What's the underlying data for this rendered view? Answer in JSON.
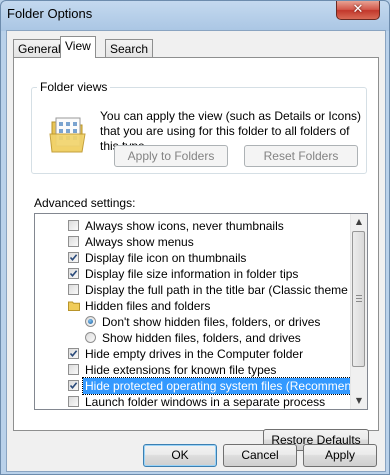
{
  "window": {
    "title": "Folder Options",
    "close_glyph": "✕"
  },
  "tabs": [
    {
      "label": "General",
      "active": false
    },
    {
      "label": "View",
      "active": true
    },
    {
      "label": "Search",
      "active": false
    }
  ],
  "folder_views": {
    "label": "Folder views",
    "icon": "folder-views-icon",
    "description": "You can apply the view (such as Details or Icons) that you are using for this folder to all folders of this type.",
    "apply_button": "Apply to Folders",
    "reset_button": "Reset Folders"
  },
  "advanced": {
    "label": "Advanced settings:",
    "items": [
      {
        "type": "checkbox",
        "label": "Always show icons, never thumbnails",
        "checked": false,
        "indent": 0
      },
      {
        "type": "checkbox",
        "label": "Always show menus",
        "checked": false,
        "indent": 0
      },
      {
        "type": "checkbox",
        "label": "Display file icon on thumbnails",
        "checked": true,
        "indent": 0
      },
      {
        "type": "checkbox",
        "label": "Display file size information in folder tips",
        "checked": true,
        "indent": 0
      },
      {
        "type": "checkbox",
        "label": "Display the full path in the title bar (Classic theme only)",
        "checked": false,
        "indent": 0
      },
      {
        "type": "folder",
        "label": "Hidden files and folders",
        "indent": 0
      },
      {
        "type": "radio",
        "label": "Don't show hidden files, folders, or drives",
        "checked": true,
        "indent": 1
      },
      {
        "type": "radio",
        "label": "Show hidden files, folders, and drives",
        "checked": false,
        "indent": 1
      },
      {
        "type": "checkbox",
        "label": "Hide empty drives in the Computer folder",
        "checked": true,
        "indent": 0
      },
      {
        "type": "checkbox",
        "label": "Hide extensions for known file types",
        "checked": false,
        "indent": 0
      },
      {
        "type": "checkbox",
        "label": "Hide protected operating system files (Recommended)",
        "checked": true,
        "indent": 0,
        "selected": true
      },
      {
        "type": "checkbox",
        "label": "Launch folder windows in a separate process",
        "checked": false,
        "indent": 0
      }
    ],
    "restore_button": "Restore Defaults"
  },
  "footer": {
    "ok": "OK",
    "cancel": "Cancel",
    "apply": "Apply"
  }
}
